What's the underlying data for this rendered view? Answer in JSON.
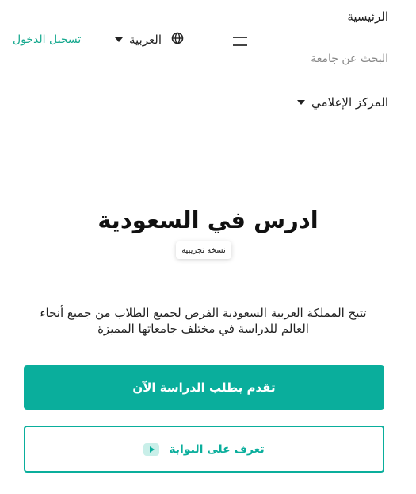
{
  "header": {
    "home_label": "الرئيسية",
    "login_label": "تسجيل الدخول",
    "language_label": "العربية",
    "search_university_label": "البحث عن جامعة",
    "media_center_label": "المركز الإعلامي"
  },
  "hero": {
    "title": "ادرس في السعودية",
    "badge": "نسخة تجريبية",
    "description": "تتيح المملكة العربية السعودية الفرص لجميع الطلاب من جميع أنحاء العالم للدراسة في مختلف جامعاتها المميزة"
  },
  "buttons": {
    "apply_label": "تقدم بطلب الدراسة الآن",
    "learn_label": "تعرف على البوابة"
  },
  "icons": {
    "globe": "globe-icon",
    "menu": "hamburger-menu-icon",
    "caret": "caret-down-icon",
    "play": "play-icon"
  },
  "colors": {
    "accent": "#0aae9c",
    "login_link": "#17a98f",
    "play_bg": "#c9efe9"
  }
}
